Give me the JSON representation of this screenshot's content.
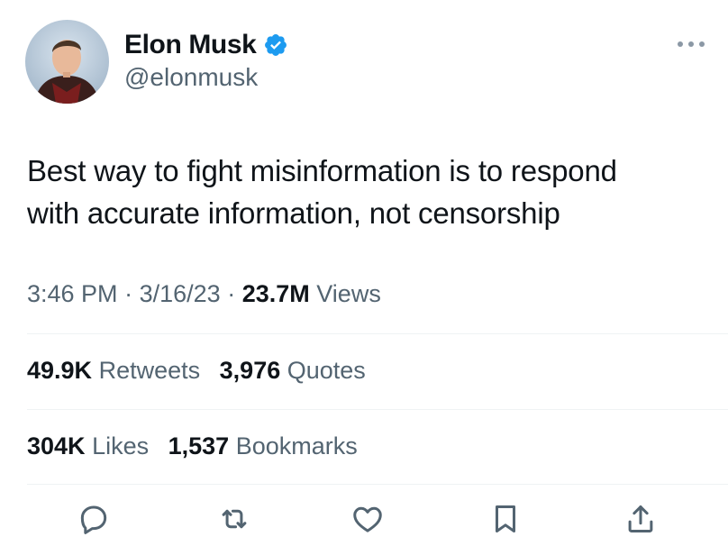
{
  "author": {
    "display_name": "Elon Musk",
    "handle": "@elonmusk",
    "verified_icon": "verified-badge-icon"
  },
  "menu_icon": "more-horizontal-icon",
  "tweet": {
    "text_line_1": "Best way to fight misinformation is to respond",
    "text_line_2": "with accurate information, not censorship"
  },
  "meta": {
    "time": "3:46 PM",
    "separator": "·",
    "date": "3/16/23",
    "views_count": "23.7M",
    "views_label": "Views"
  },
  "stats": {
    "retweets_count": "49.9K",
    "retweets_label": "Retweets",
    "quotes_count": "3,976",
    "quotes_label": "Quotes",
    "likes_count": "304K",
    "likes_label": "Likes",
    "bookmarks_count": "1,537",
    "bookmarks_label": "Bookmarks"
  },
  "actions": {
    "reply_icon": "reply-icon",
    "retweet_icon": "retweet-icon",
    "like_icon": "heart-icon",
    "bookmark_icon": "bookmark-icon",
    "share_icon": "share-icon"
  },
  "colors": {
    "text_primary": "#0f1419",
    "text_secondary": "#536471",
    "verified_blue": "#1d9bf0",
    "divider": "#eff3f4"
  }
}
